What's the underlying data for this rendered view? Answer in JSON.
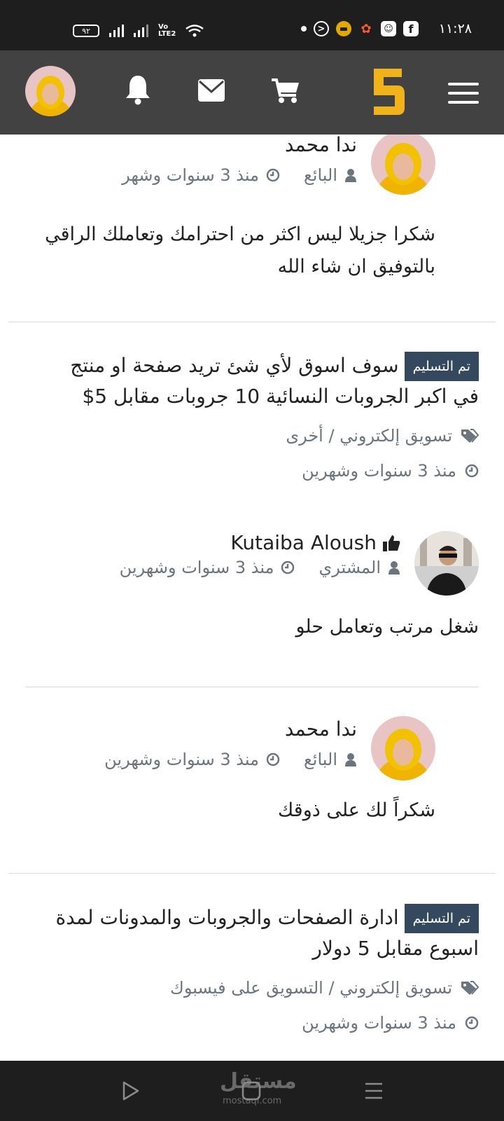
{
  "status_bar": {
    "time": "١١:٢٨",
    "battery": "٩٢",
    "network": "Vo LTE2"
  },
  "header": {
    "icons": [
      "menu-icon",
      "logo",
      "cart-icon",
      "mail-icon",
      "bell-icon",
      "profile-avatar"
    ],
    "logo_color": "#f0b31a"
  },
  "comments": [
    {
      "name": "ندا محمد",
      "role": "البائع",
      "time": "منذ 3 سنوات وشهر",
      "text_line1": "شكرا جزيلا ليس اكثر من احترامك وتعاملك الراقي",
      "text_line2": "بالتوفيق ان شاء الله"
    }
  ],
  "projects": [
    {
      "badge": "تم التسليم",
      "title_line1": "سوف اسوق لأي شئ تريد صفحة او منتج",
      "title_line2": "في اكبر الجروبات النسائية 10 جروبات مقابل 5$",
      "category": "تسويق إلكتروني / أخرى",
      "time": "منذ 3 سنوات وشهرين",
      "buyer": {
        "name": "Kutaiba Aloush",
        "role": "المشتري",
        "time": "منذ 3 سنوات وشهرين",
        "text": "شغل مرتب وتعامل حلو"
      },
      "seller_reply": {
        "name": "ندا محمد",
        "role": "البائع",
        "time": "منذ 3 سنوات وشهرين",
        "text": "شكراً لك على ذوقك"
      }
    },
    {
      "badge": "تم التسليم",
      "title_line1": "ادارة الصفحات والجروبات والمدونات لمدة",
      "title_line2": "اسبوع مقابل 5 دولار",
      "category": "تسويق إلكتروني / التسويق على فيسبوك",
      "time": "منذ 3 سنوات وشهرين"
    }
  ],
  "nav_bar": {
    "watermark": "مستقل",
    "watermark_sub": "mostaql.com"
  },
  "colors": {
    "header_bg": "#424242",
    "badge_bg": "#34495e",
    "meta_text": "#6c757d",
    "logo": "#f0b31a"
  }
}
